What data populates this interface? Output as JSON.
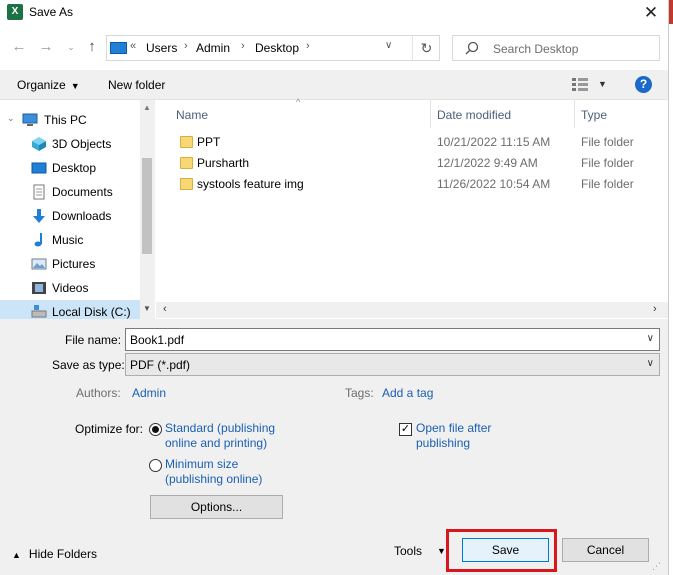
{
  "window": {
    "title": "Save As",
    "app_icon": "excel-icon",
    "close_glyph": "✕"
  },
  "address": {
    "crumbs": [
      "Users",
      "Admin",
      "Desktop"
    ],
    "overflow": "«",
    "separator": "›"
  },
  "search": {
    "placeholder": "Search Desktop"
  },
  "toolbar": {
    "organize": "Organize",
    "new_folder": "New folder",
    "help": "?"
  },
  "nav": {
    "items": [
      {
        "label": "This PC",
        "icon": "this-pc-icon"
      },
      {
        "label": "3D Objects",
        "icon": "3d-objects-icon"
      },
      {
        "label": "Desktop",
        "icon": "desktop-icon"
      },
      {
        "label": "Documents",
        "icon": "documents-icon"
      },
      {
        "label": "Downloads",
        "icon": "downloads-icon"
      },
      {
        "label": "Music",
        "icon": "music-icon"
      },
      {
        "label": "Pictures",
        "icon": "pictures-icon"
      },
      {
        "label": "Videos",
        "icon": "videos-icon"
      },
      {
        "label": "Local Disk (C:)",
        "icon": "local-disk-icon"
      }
    ]
  },
  "file_list": {
    "columns": [
      "Name",
      "Date modified",
      "Type"
    ],
    "rows": [
      {
        "name": "PPT",
        "date": "10/21/2022 11:15 AM",
        "type": "File folder"
      },
      {
        "name": "Pursharth",
        "date": "12/1/2022 9:49 AM",
        "type": "File folder"
      },
      {
        "name": "systools feature img",
        "date": "11/26/2022 10:54 AM",
        "type": "File folder"
      }
    ]
  },
  "form": {
    "file_name_label": "File name:",
    "file_name_value": "Book1.pdf",
    "save_type_label": "Save as type:",
    "save_type_value": "PDF (*.pdf)",
    "authors_label": "Authors:",
    "authors_value": "Admin",
    "tags_label": "Tags:",
    "tags_value": "Add a tag",
    "optimize_label": "Optimize for:",
    "optimize_standard": "Standard (publishing\nonline and printing)",
    "optimize_minimum": "Minimum size\n(publishing online)",
    "options_button": "Options...",
    "open_after": "Open file after\npublishing",
    "open_after_checked": true
  },
  "footer": {
    "hide_folders": "Hide Folders",
    "tools": "Tools",
    "save": "Save",
    "cancel": "Cancel"
  },
  "colors": {
    "link_blue": "#1a5fb4",
    "highlight_red": "#d8161d",
    "excel_green": "#1e7145"
  }
}
